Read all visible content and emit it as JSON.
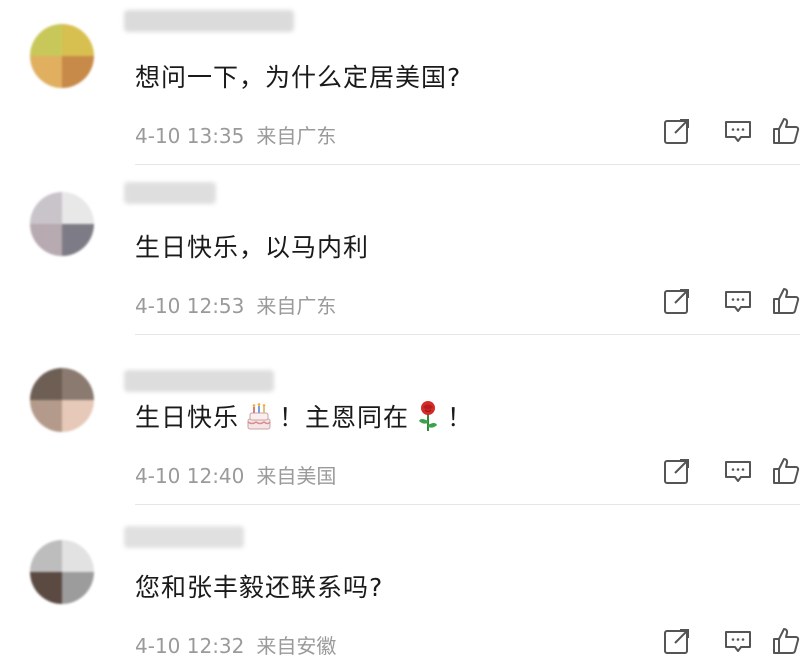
{
  "comments": [
    {
      "text": "想问一下，为什么定居美国?",
      "time": "4-10 13:35",
      "location": "来自广东"
    },
    {
      "text": "生日快乐，以马内利",
      "time": "4-10 12:53",
      "location": "来自广东"
    },
    {
      "text_before": "生日快乐",
      "text_middle": "！主恩同在",
      "text_after": "！",
      "emoji_1": "birthday-cake",
      "emoji_2": "rose",
      "time": "4-10 12:40",
      "location": "来自美国"
    },
    {
      "text": "您和张丰毅还联系吗?",
      "time": "4-10 12:32",
      "location": "来自安徽"
    }
  ],
  "icons": {
    "share": "share-icon",
    "reply": "comment-icon",
    "like": "thumbs-up-icon"
  },
  "colors": {
    "text": "#1a1a1a",
    "meta": "#9a9a9a",
    "icon": "#555555",
    "divider": "#e6e6e6"
  }
}
